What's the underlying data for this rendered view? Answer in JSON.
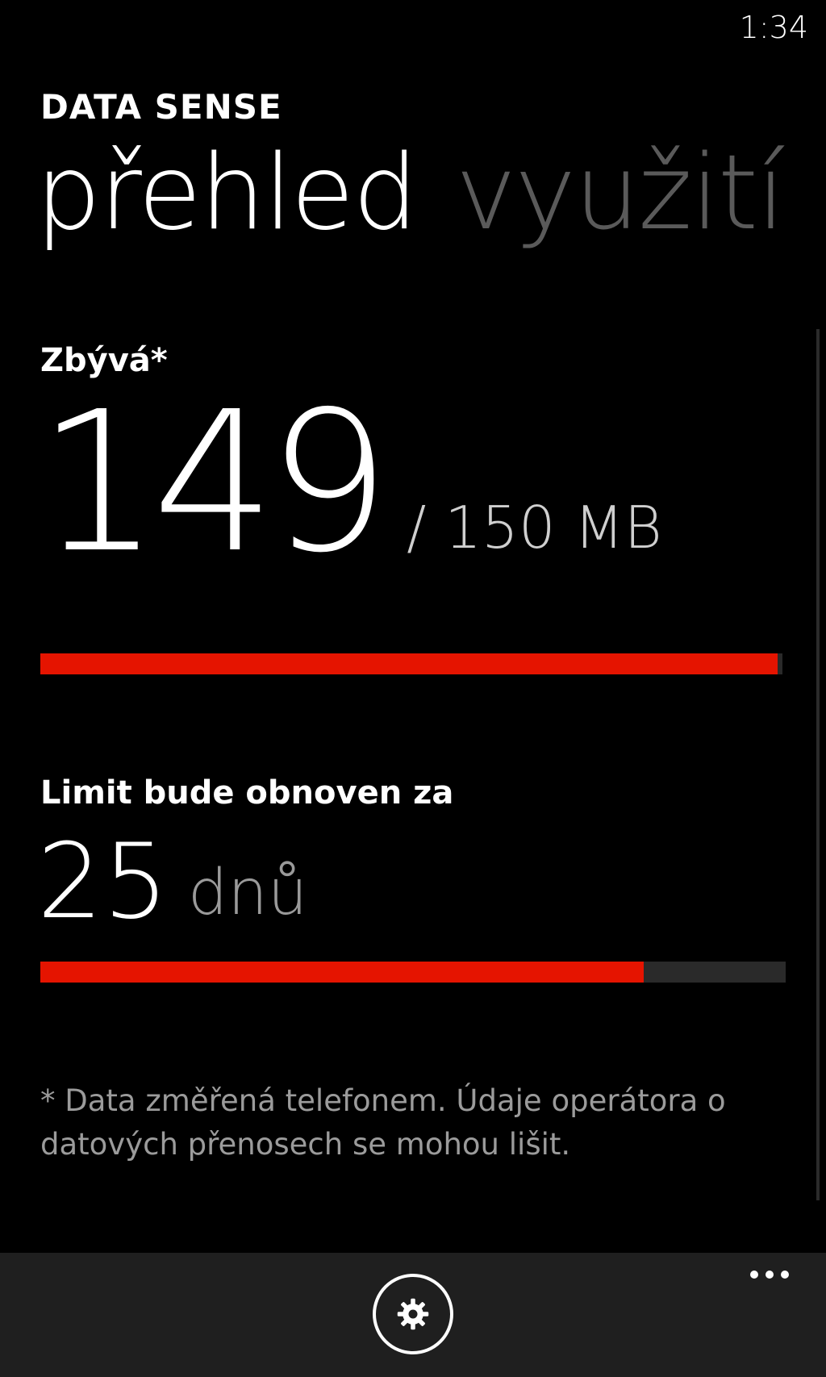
{
  "status_bar": {
    "time": "1:34"
  },
  "header": {
    "app_title": "DATA SENSE"
  },
  "pivot": {
    "items": [
      {
        "label": "přehled",
        "active": true
      },
      {
        "label": "využití",
        "active": false
      }
    ]
  },
  "remaining": {
    "label": "Zbývá*",
    "value": "149",
    "total": "/ 150 MB",
    "fraction": 0.993
  },
  "reset": {
    "label": "Limit bude obnoven za",
    "value": "25",
    "unit": "dnů",
    "fraction": 0.81
  },
  "footnote": "* Data změřená telefonem. Údaje operátora o datových přenosech se mohou lišit.",
  "app_bar": {
    "buttons": [
      {
        "icon": "gear-icon"
      }
    ],
    "more_icon": "ellipsis-icon"
  },
  "colors": {
    "accent": "#e51400",
    "track": "#2a2a2a",
    "inactive_pivot": "#5a5a5a",
    "app_bar": "#1f1f1f"
  }
}
